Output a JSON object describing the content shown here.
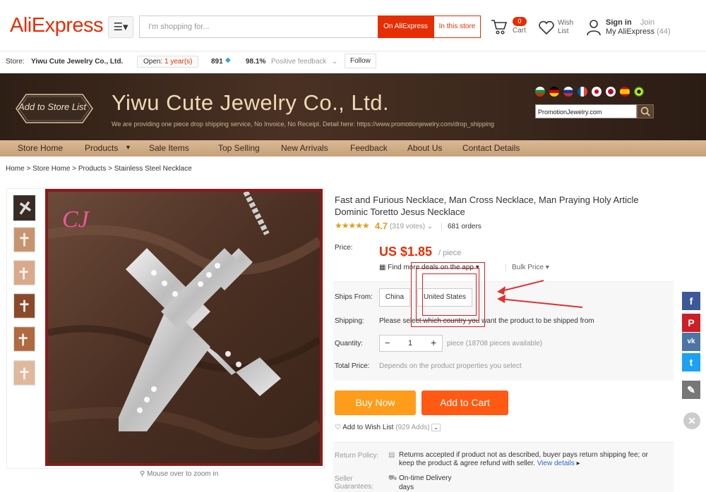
{
  "header": {
    "logo": "AliExpress",
    "search_placeholder": "I'm shopping for...",
    "on_aliexpress": "On AliExpress",
    "in_this_store": "In this store",
    "cart_count": "0",
    "cart_label": "Cart",
    "wish_list": "Wish List",
    "sign_in": "Sign in",
    "join": "Join",
    "my_aliexpress": "My AliExpress",
    "my_count": "(44)"
  },
  "storebar": {
    "store_label": "Store:",
    "store_name": "Yiwu Cute Jewelry Co., Ltd.",
    "open_label": "Open:",
    "open_years": "1 year(s)",
    "score": "891",
    "feedback_pct": "98.1%",
    "feedback_label": "Positive feedback",
    "follow": "Follow"
  },
  "banner": {
    "add_to_store_list": "Add to Store List",
    "title": "Yiwu Cute Jewelry Co., Ltd.",
    "subtitle": "We are providing one piece drop shipping service, No Invoice, No Receipt. Detail here: https://www.promotionjewelry.com/drop_shipping",
    "search_value": "PromotionJewelry.com"
  },
  "nav": {
    "items": [
      "Store Home",
      "Products",
      "Sale Items",
      "Top Selling",
      "New Arrivals",
      "Feedback",
      "About Us",
      "Contact Details"
    ]
  },
  "breadcrumb": [
    "Home",
    "Store Home",
    "Products",
    "Stainless Steel Necklace"
  ],
  "gallery": {
    "zoom_hint": "Mouse over to zoom in"
  },
  "product": {
    "title": "Fast and Furious Necklace, Man Cross Necklace, Man Praying Holy Article Dominic Toretto Jesus Necklace",
    "rating": "4.7",
    "votes": "(319 votes)",
    "orders": "681 orders",
    "price_label": "Price:",
    "price": "US $1.85",
    "per_piece": "/ piece",
    "app_deals": "Find more deals on the app",
    "bulk_price": "Bulk Price",
    "ships_from_label": "Ships From:",
    "ships_from_options": [
      "China",
      "United States"
    ],
    "shipping_label": "Shipping:",
    "shipping_msg": "Please select which country you want the product to be shipped from",
    "quantity_label": "Quantity:",
    "quantity_value": "1",
    "quantity_info": "piece (18708 pieces available)",
    "total_label": "Total Price:",
    "total_msg": "Depends on the product properties you select",
    "buy_now": "Buy Now",
    "add_to_cart": "Add to Cart",
    "add_to_wishlist": "Add to Wish List",
    "wish_count": "(929 Adds)",
    "return_label": "Return Policy:",
    "return_text": "Returns accepted if product not as described, buyer pays return shipping fee; or keep the product & agree refund with seller.",
    "view_details": "View details",
    "seller_label": "Seller Guarantees:",
    "ontime": "On-time Delivery",
    "days": "days"
  },
  "colors": {
    "accent": "#e62e04",
    "buy_now": "#ff9c1a",
    "add_cart": "#ff5a13",
    "banner_text": "#f0d9b5"
  }
}
